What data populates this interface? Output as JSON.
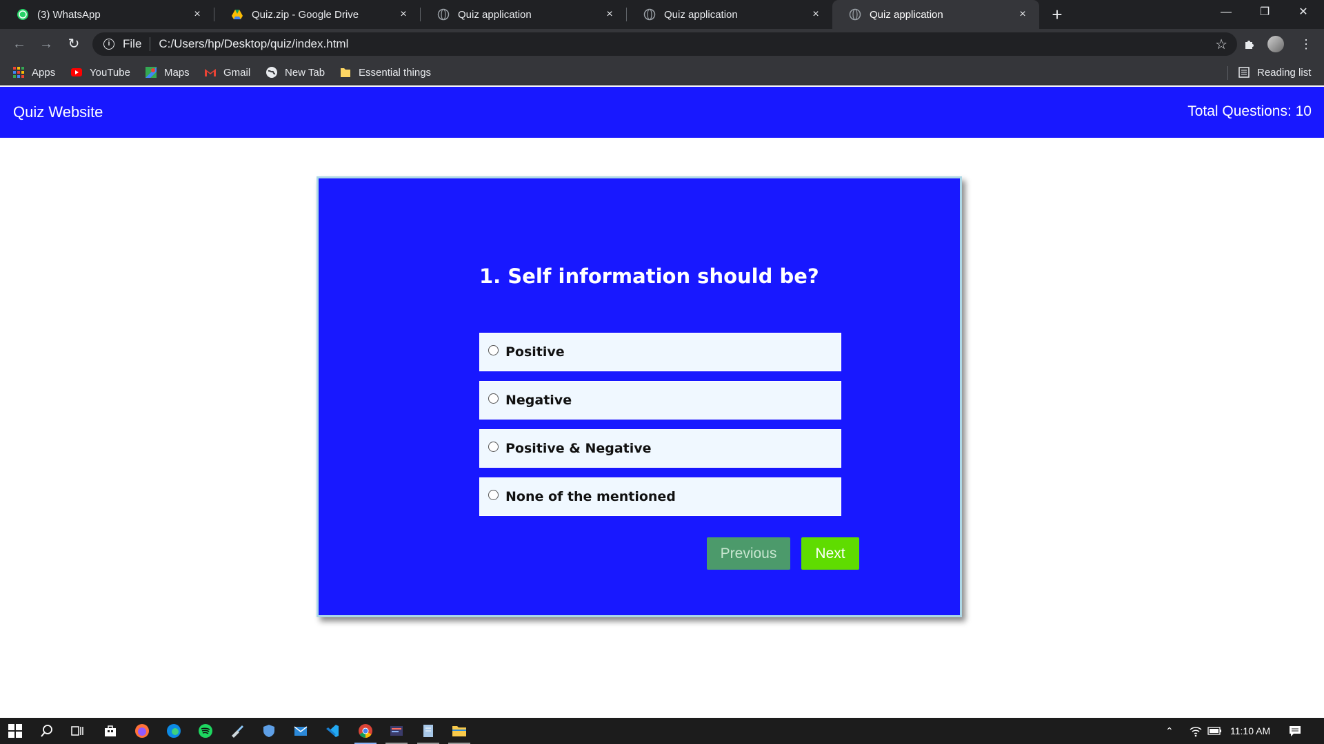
{
  "browser": {
    "tabs": [
      {
        "title": "(3) WhatsApp",
        "icon": "whatsapp-icon"
      },
      {
        "title": "Quiz.zip - Google Drive",
        "icon": "google-drive-icon"
      },
      {
        "title": "Quiz application",
        "icon": "globe-icon"
      },
      {
        "title": "Quiz application",
        "icon": "globe-icon"
      },
      {
        "title": "Quiz application",
        "icon": "globe-icon",
        "active": true
      }
    ],
    "tab_close": "×",
    "new_tab": "+",
    "address": {
      "scheme": "File",
      "url": "C:/Users/hp/Desktop/quiz/index.html"
    },
    "bookmarks": [
      {
        "label": "Apps",
        "icon": "apps-grid-icon"
      },
      {
        "label": "YouTube",
        "icon": "youtube-icon"
      },
      {
        "label": "Maps",
        "icon": "maps-icon"
      },
      {
        "label": "Gmail",
        "icon": "gmail-icon"
      },
      {
        "label": "New Tab",
        "icon": "globe-icon"
      },
      {
        "label": "Essential things",
        "icon": "folder-icon"
      }
    ],
    "reading_list": "Reading list"
  },
  "site": {
    "brand": "Quiz Website",
    "total_questions": "Total Questions: 10"
  },
  "quiz": {
    "question": "1. Self information should be?",
    "options": [
      "Positive",
      "Negative",
      "Positive & Negative",
      "None of the mentioned"
    ],
    "previous_label": "Previous",
    "next_label": "Next"
  },
  "taskbar": {
    "time": "11:10 AM"
  },
  "colors": {
    "brand_blue": "#1818ff",
    "card_border": "#add8e6",
    "option_bg": "#f0f8ff",
    "next_green": "#5fdc00",
    "prev_green": "#4c9a6b"
  }
}
